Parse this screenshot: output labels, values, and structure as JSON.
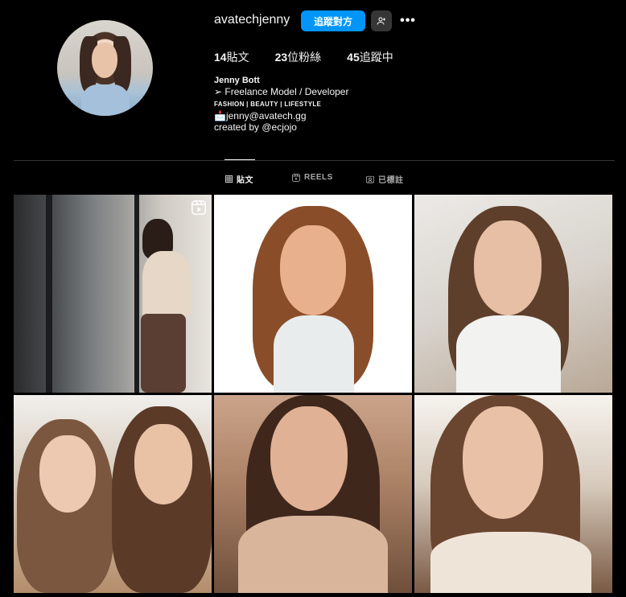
{
  "profile": {
    "username": "avatechjenny",
    "follow_label": "追蹤對方",
    "more_label": "•••",
    "stats": [
      {
        "count": "14",
        "label": "貼文"
      },
      {
        "count": "23",
        "label": "位粉絲"
      },
      {
        "count": "45",
        "label": "追蹤中"
      }
    ],
    "full_name": "Jenny Bott",
    "bio_line1": "➢ Freelance Model / Developer",
    "bio_line2": "FASHION | BEAUTY | LIFESTYLE",
    "bio_line3": "📩jenny@avatech.gg",
    "bio_line4": "created by @ecjojo"
  },
  "tabs": [
    {
      "label": "貼文",
      "icon": "grid-icon",
      "active": true
    },
    {
      "label": "REELS",
      "icon": "reels-icon",
      "active": false
    },
    {
      "label": "已標註",
      "icon": "tagged-icon",
      "active": false
    }
  ],
  "colors": {
    "background": "#000000",
    "accent": "#0095f6",
    "secondary_button": "#363636",
    "muted_text": "#a8a8a8"
  },
  "posts": [
    {
      "type": "reel",
      "icon": "reels-icon"
    },
    {
      "type": "image"
    },
    {
      "type": "image"
    },
    {
      "type": "image"
    },
    {
      "type": "image"
    },
    {
      "type": "image"
    }
  ]
}
